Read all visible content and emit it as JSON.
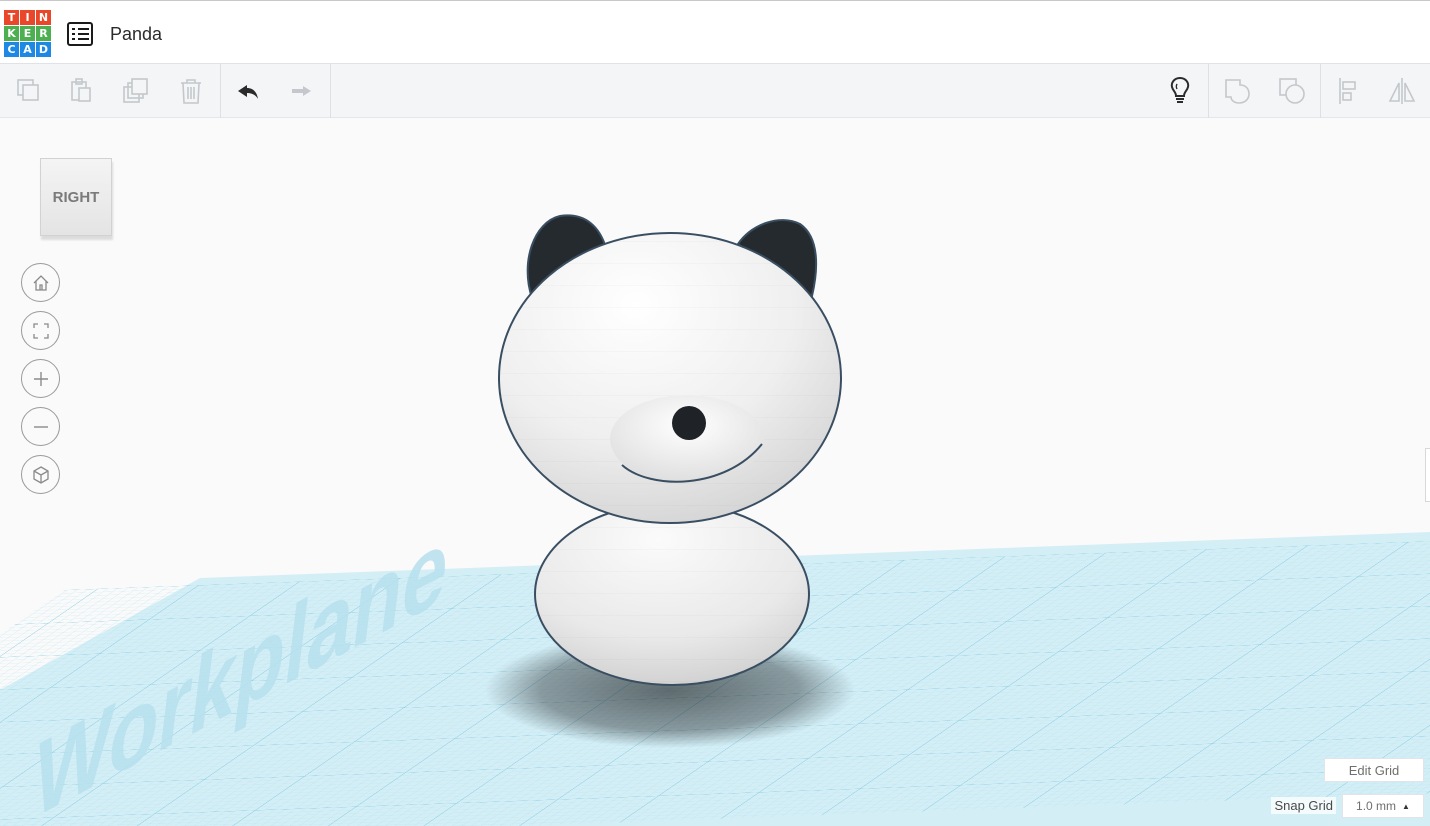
{
  "app": {
    "logo_letters": [
      "T",
      "I",
      "N",
      "K",
      "E",
      "R",
      "C",
      "A",
      "D"
    ],
    "logo_colors": [
      "#e8472a",
      "#e8472a",
      "#e8472a",
      "#4caf50",
      "#4caf50",
      "#4caf50",
      "#1e88e5",
      "#1e88e5",
      "#1e88e5"
    ],
    "project_title": "Panda",
    "menu_icon": "list-icon"
  },
  "toolbar": {
    "left_tools": [
      "copy-icon",
      "paste-icon",
      "duplicate-icon",
      "delete-icon",
      "undo-icon",
      "redo-icon"
    ],
    "right_tools": [
      "lightbulb-icon",
      "shape-show-icon",
      "shape-hide-icon",
      "align-icon",
      "mirror-icon"
    ]
  },
  "viewport": {
    "view_cube_label": "RIGHT",
    "view_controls": [
      "home-view-icon",
      "fit-view-icon",
      "zoom-in-icon",
      "zoom-out-icon",
      "ortho-view-icon"
    ],
    "workplane_text": "Workplane",
    "workplane_color": "#cbe9f3",
    "grid_line_color": "#8fd0e6"
  },
  "grid": {
    "edit_grid_label": "Edit Grid",
    "snap_grid_label": "Snap Grid",
    "snap_value": "1.0 mm",
    "snap_caret": "▲"
  }
}
